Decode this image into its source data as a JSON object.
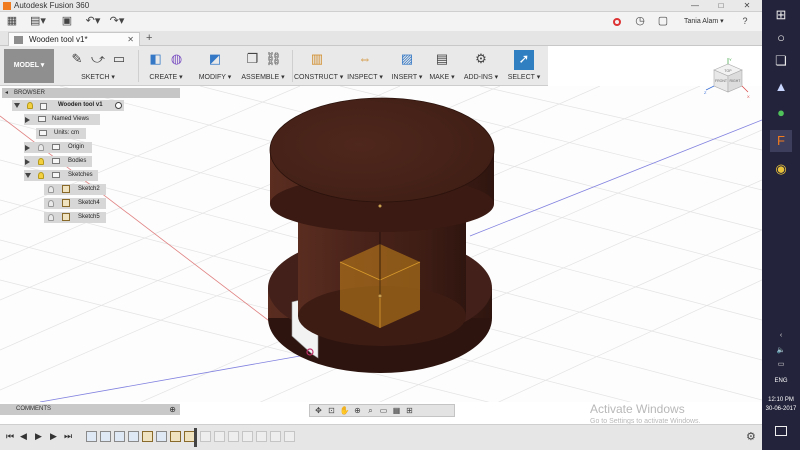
{
  "window": {
    "title": "Autodesk Fusion 360",
    "minimize": "—",
    "maximize": "□",
    "close": "✕"
  },
  "quick_access": {
    "user_name": "Tania Alam ▾",
    "help": "?"
  },
  "document": {
    "tab_title": "Wooden tool v1*",
    "close": "✕",
    "new_tab": "+"
  },
  "toolbar": {
    "workspace": "MODEL ▾",
    "groups": [
      {
        "label": "SKETCH ▾"
      },
      {
        "label": "CREATE ▾"
      },
      {
        "label": "MODIFY ▾"
      },
      {
        "label": "ASSEMBLE ▾"
      },
      {
        "label": "CONSTRUCT ▾"
      },
      {
        "label": "INSPECT ▾"
      },
      {
        "label": "INSERT ▾"
      },
      {
        "label": "MAKE ▾"
      },
      {
        "label": "ADD-INS ▾"
      },
      {
        "label": "SELECT ▾"
      }
    ]
  },
  "browser": {
    "title": "BROWSER",
    "root": "Wooden tool v1",
    "items": [
      {
        "label": "Named Views"
      },
      {
        "label": "Units: cm"
      },
      {
        "label": "Origin"
      },
      {
        "label": "Bodies"
      },
      {
        "label": "Sketches"
      }
    ],
    "sketches": [
      {
        "label": "Sketch2"
      },
      {
        "label": "Sketch4"
      },
      {
        "label": "Sketch5"
      }
    ]
  },
  "comments": {
    "title": "COMMENTS"
  },
  "viewcube": {
    "top": "TOP",
    "front": "FRONT",
    "right": "RIGHT",
    "axis_x": "X",
    "axis_y": "Y",
    "axis_z": "Z"
  },
  "watermark": {
    "line1": "Activate Windows",
    "line2": "Go to Settings to activate Windows."
  },
  "taskbar": {
    "language": "ENG",
    "time": "12:10 PM",
    "date": "30-06-2017"
  },
  "colors": {
    "wood": "#4a231a",
    "wood_dark": "#3a1a12",
    "accent": "#2f7fc1",
    "taskbar": "#23233b"
  }
}
